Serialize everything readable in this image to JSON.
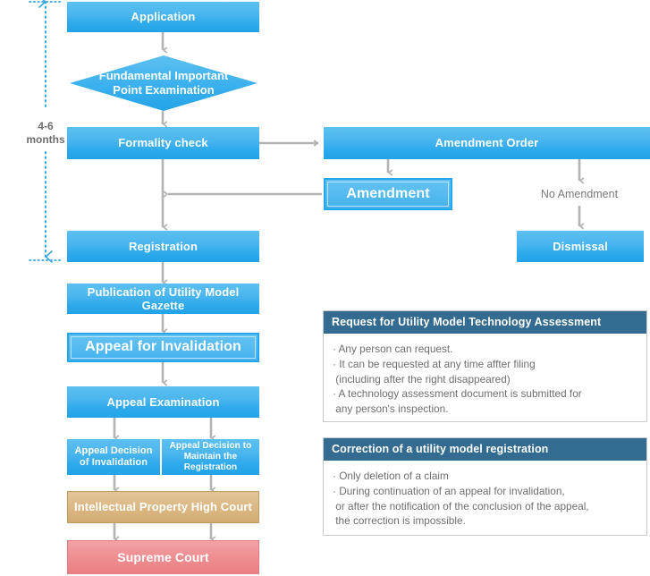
{
  "diagram": {
    "title": "Utility Model Application Flow",
    "colors": {
      "box_blue": "#2eaaec",
      "box_tan": "#d9b578",
      "box_red": "#ea7f84",
      "panel_header": "#336b91",
      "arrow_gray": "#b3b3b3",
      "timeline_blue": "#3aa7e0"
    },
    "timeline": {
      "label_line1": "4-6",
      "label_line2": "months"
    },
    "nodes": {
      "application": "Application",
      "fundamental_exam_line1": "Fundamental Important",
      "fundamental_exam_line2": "Point Examination",
      "formality_check": "Formality check",
      "amendment_order": "Amendment Order",
      "amendment": "Amendment",
      "no_amendment": "No Amendment",
      "dismissal": "Dismissal",
      "registration": "Registration",
      "publication": "Publication of Utility Model Gazette",
      "appeal_invalidation": "Appeal for Invalidation",
      "appeal_examination": "Appeal Examination",
      "decision_invalidation_line1": "Appeal Decision",
      "decision_invalidation_line2": "of Invalidation",
      "decision_maintain_line1": "Appeal Decision to",
      "decision_maintain_line2": "Maintain the Registration",
      "ip_high_court": "Intellectual Property High Court",
      "supreme_court": "Supreme Court"
    },
    "panels": [
      {
        "header": "Request for Utility Model Technology Assessment",
        "lines": [
          "· Any person can request.",
          "· It can be requested at any time affter filing",
          " (including after the right disappeared)",
          "· A technology assessment document is submitted for",
          " any person's inspection."
        ]
      },
      {
        "header": "Correction of a utility model registration",
        "lines": [
          "· Only deletion of a claim",
          "· During continuation of an appeal for invalidation,",
          " or after the notification of the conclusion of the appeal,",
          " the correction is impossible."
        ]
      }
    ]
  }
}
